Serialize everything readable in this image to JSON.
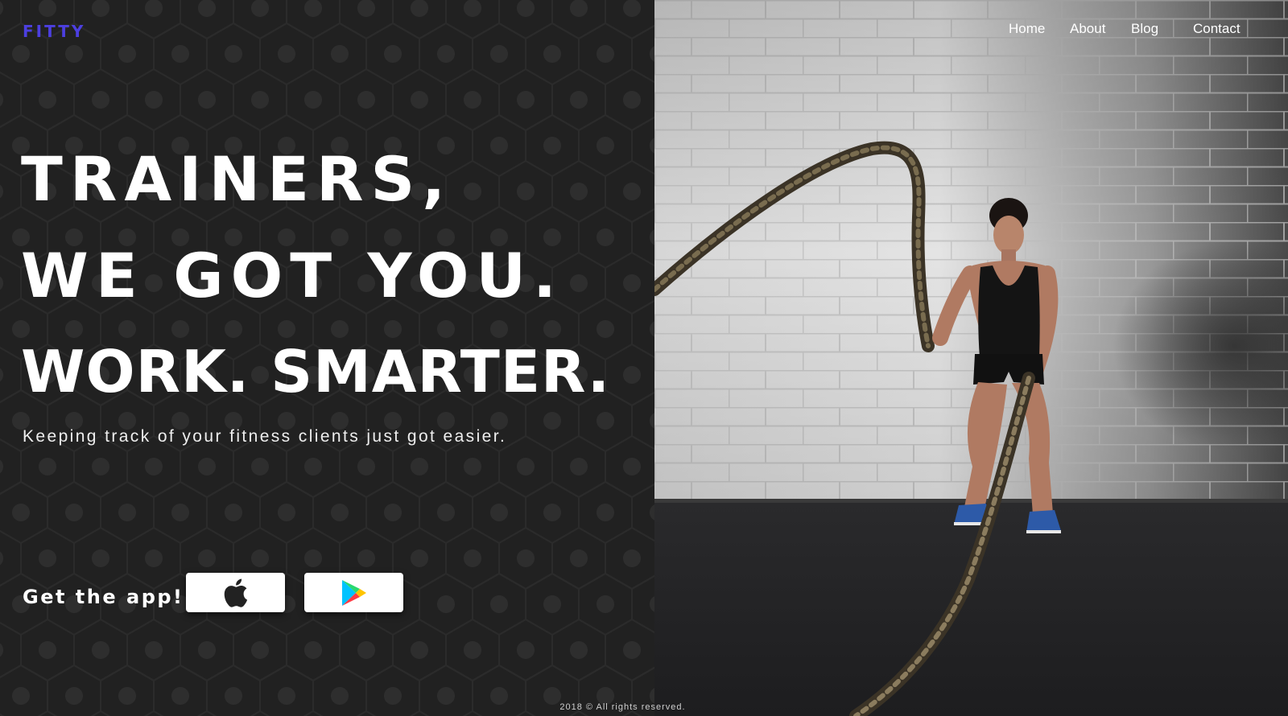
{
  "brand": {
    "logo_text": "FITTY",
    "accent_color": "#4c3fe0"
  },
  "nav": {
    "items": [
      "Home",
      "About",
      "Blog",
      "Contact"
    ]
  },
  "hero": {
    "headline_line1": "TRAINERS,",
    "headline_line2": "WE GOT YOU.",
    "headline_line3": "WORK. SMARTER.",
    "subtitle": "Keeping track of your fitness clients just got easier."
  },
  "app_promo": {
    "label": "Get the app!",
    "buttons": [
      {
        "icon": "apple-icon"
      },
      {
        "icon": "google-play-icon"
      }
    ]
  },
  "footer": {
    "text": "2018 © All rights reserved."
  },
  "colors": {
    "background": "#212121",
    "text": "#ffffff"
  }
}
